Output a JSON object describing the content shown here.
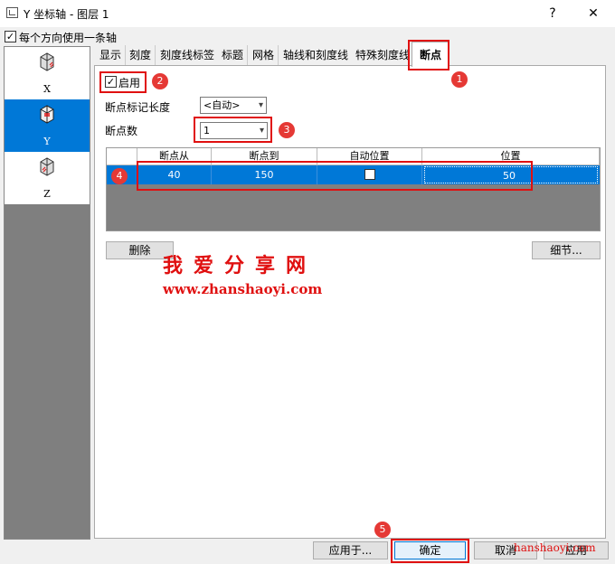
{
  "window": {
    "title": "Y 坐标轴 - 图层 1",
    "help": "?",
    "close": "✕"
  },
  "top_checkbox": {
    "label": "每个方向使用一条轴",
    "checked": true
  },
  "axes": [
    {
      "label": "X",
      "selected": false
    },
    {
      "label": "Y",
      "selected": true
    },
    {
      "label": "Z",
      "selected": false
    }
  ],
  "tabs": [
    "显示",
    "刻度",
    "刻度线标签",
    "标题",
    "网格",
    "轴线和刻度线",
    "特殊刻度线",
    "断点"
  ],
  "active_tab": "断点",
  "enable": {
    "label": "启用",
    "checked": true
  },
  "break_mark_length": {
    "label": "断点标记长度",
    "value": "<自动>"
  },
  "break_count": {
    "label": "断点数",
    "value": "1"
  },
  "table": {
    "headers": [
      "断点从",
      "断点到",
      "自动位置",
      "位置"
    ],
    "rows": [
      {
        "from": "40",
        "to": "150",
        "auto": false,
        "position": "50"
      }
    ]
  },
  "buttons": {
    "delete": "删除",
    "detail": "细节...",
    "apply_to": "应用于...",
    "ok": "确定",
    "cancel": "取消",
    "apply": "应用"
  },
  "badges": [
    "1",
    "2",
    "3",
    "4",
    "5"
  ],
  "watermark": {
    "cn": "我爱分享网",
    "url": "www.zhanshaoyi.com",
    "overlay": "hanshaoyi.com"
  },
  "colors": {
    "selection": "#0078d7",
    "highlight": "#e01010",
    "badge": "#e53935"
  }
}
